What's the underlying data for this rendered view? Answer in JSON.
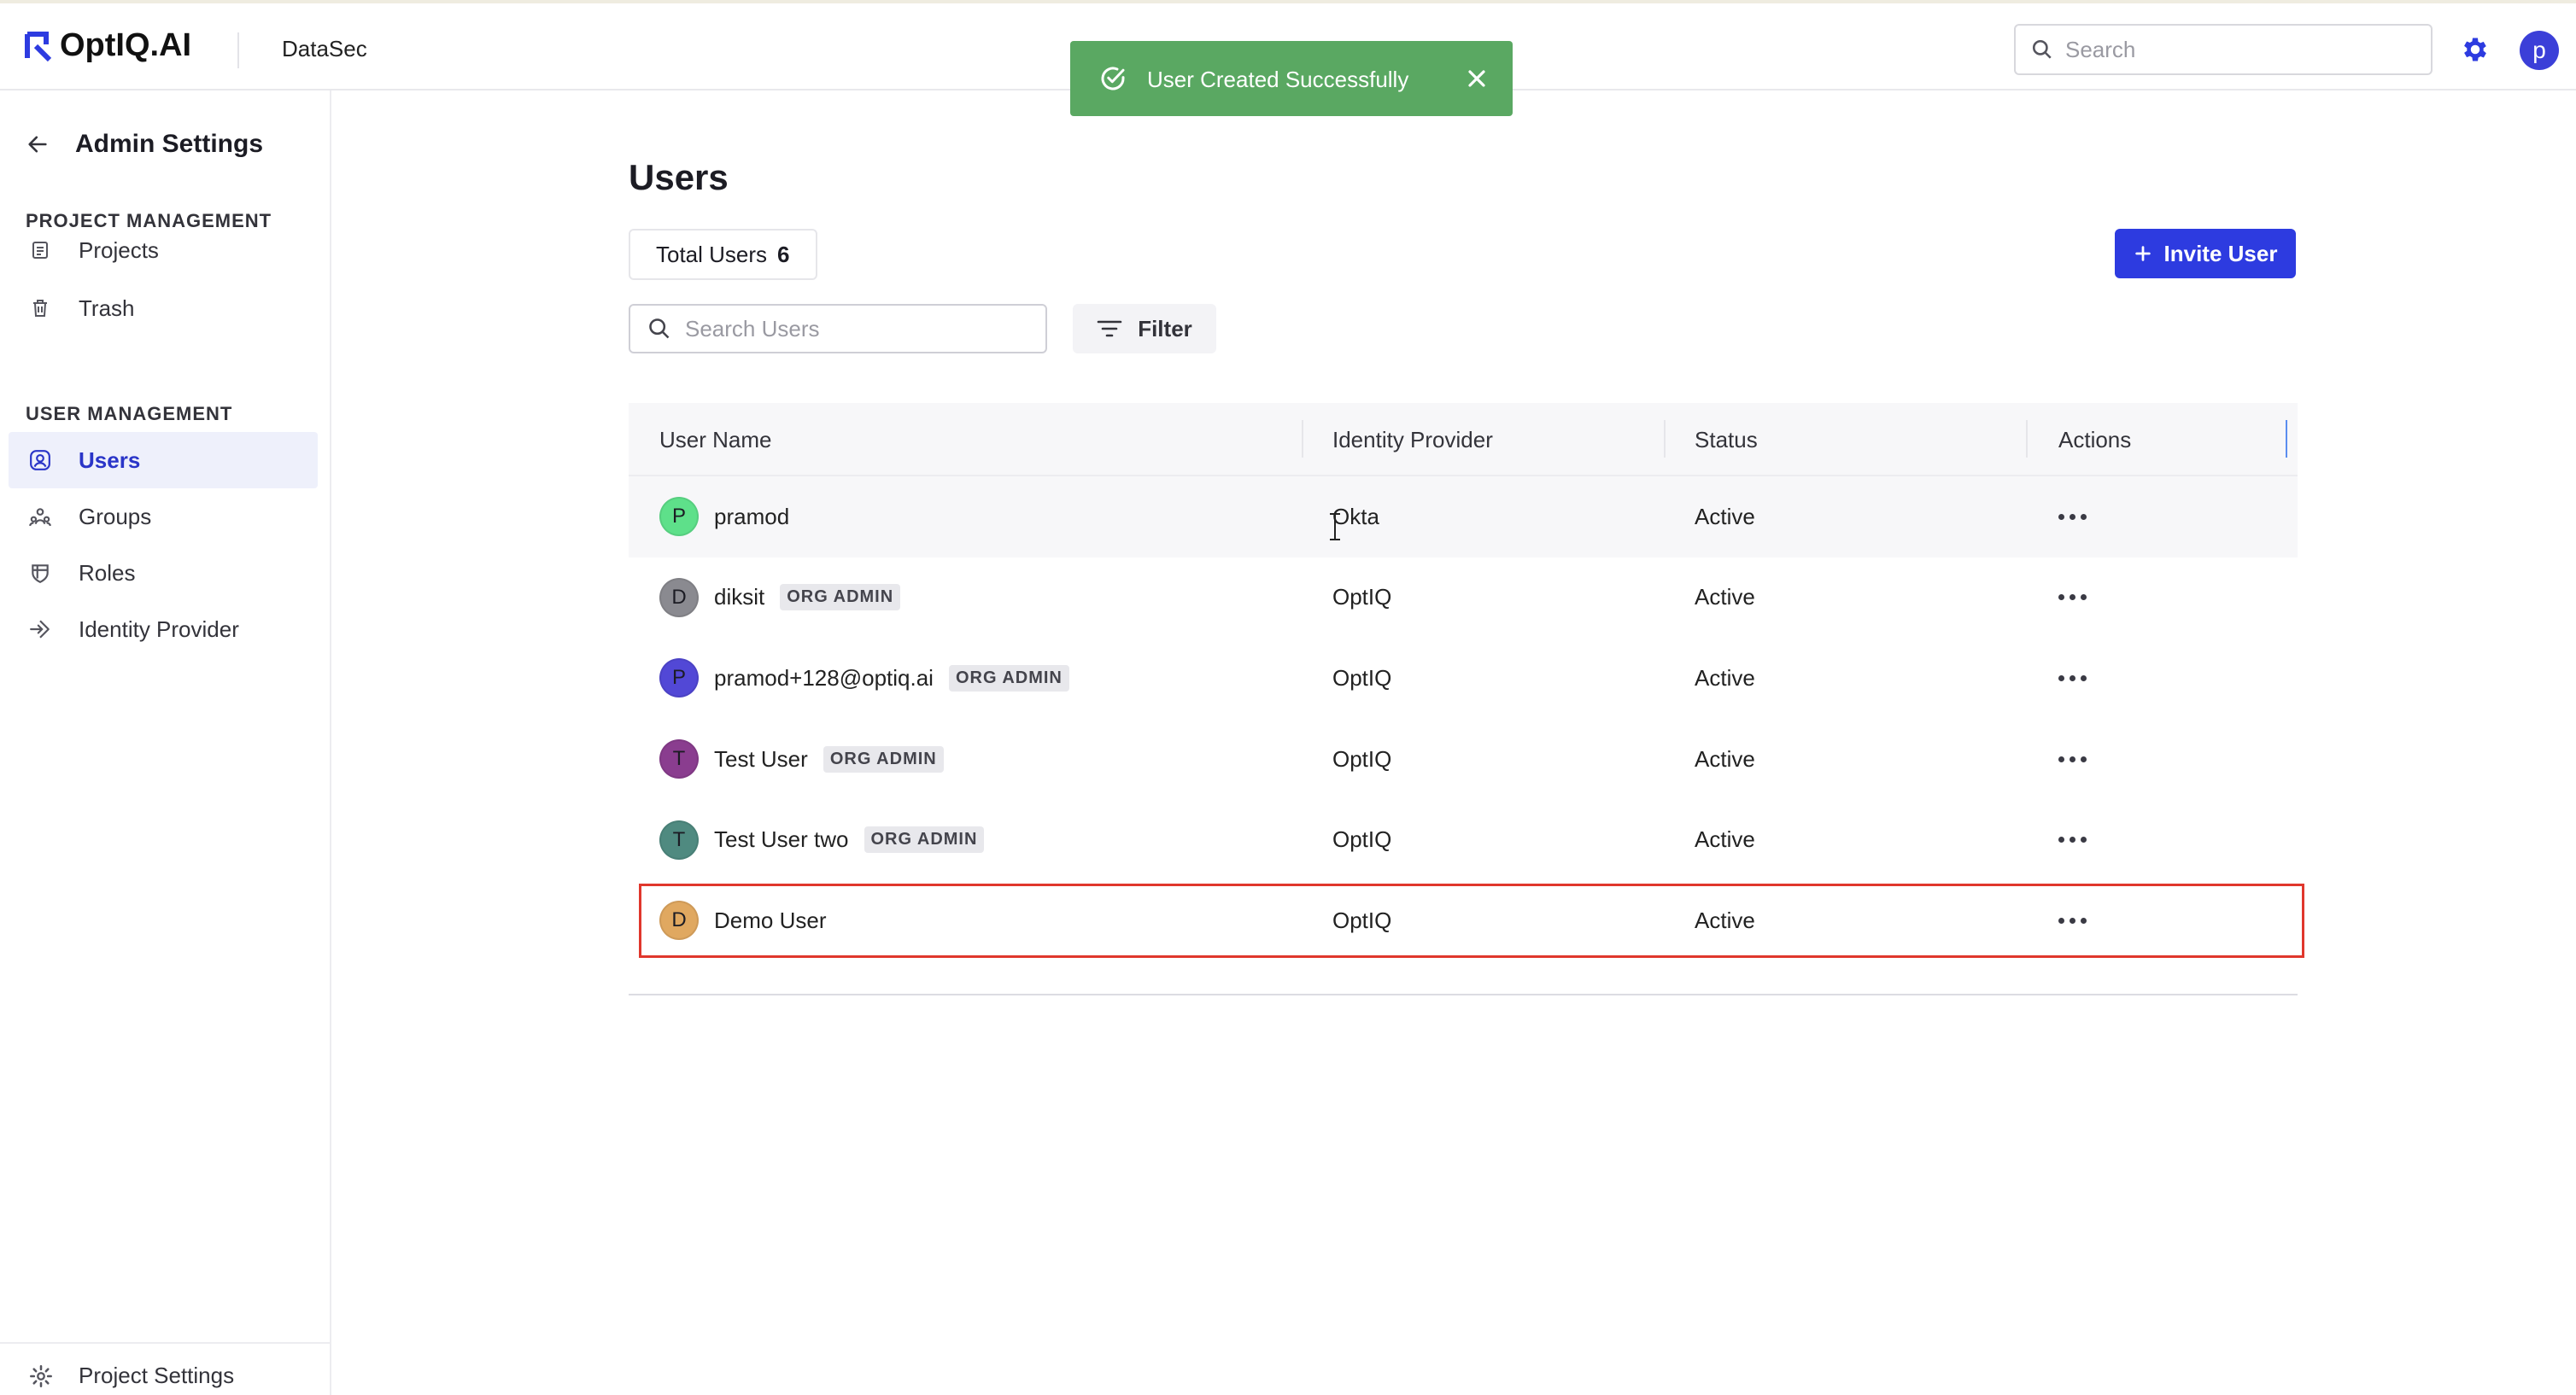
{
  "header": {
    "logo_text": "OptIQ.AI",
    "project_name": "DataSec",
    "search_placeholder": "Search",
    "avatar_initial": "p",
    "accent": "#2d3be0"
  },
  "toast": {
    "message": "User Created Successfully",
    "color": "#5aa862"
  },
  "sidebar": {
    "back_title": "Admin Settings",
    "sections": [
      {
        "title": "PROJECT MANAGEMENT",
        "items": [
          {
            "label": "Projects",
            "icon": "document-icon"
          },
          {
            "label": "Trash",
            "icon": "trash-icon"
          }
        ]
      },
      {
        "title": "USER MANAGEMENT",
        "items": [
          {
            "label": "Users",
            "icon": "user-circle-icon",
            "active": true
          },
          {
            "label": "Groups",
            "icon": "groups-icon"
          },
          {
            "label": "Roles",
            "icon": "shield-icon"
          },
          {
            "label": "Identity Provider",
            "icon": "login-icon"
          }
        ]
      }
    ],
    "footer_label": "Project Settings"
  },
  "main": {
    "title": "Users",
    "total_users_label": "Total Users",
    "total_users_count": "6",
    "invite_label": "Invite User",
    "search_placeholder": "Search Users",
    "filter_label": "Filter",
    "columns": [
      "User Name",
      "Identity Provider",
      "Status",
      "Actions"
    ],
    "rows": [
      {
        "initial": "P",
        "name": "pramod",
        "badge": "",
        "provider": "Okta",
        "status": "Active",
        "avatar_color": "#5ee08a"
      },
      {
        "initial": "D",
        "name": "diksit",
        "badge": "ORG ADMIN",
        "provider": "OptIQ",
        "status": "Active",
        "avatar_color": "#8a8a90"
      },
      {
        "initial": "P",
        "name": "pramod+128@optiq.ai",
        "badge": "ORG ADMIN",
        "provider": "OptIQ",
        "status": "Active",
        "avatar_color": "#5248d6"
      },
      {
        "initial": "T",
        "name": "Test User",
        "badge": "ORG ADMIN",
        "provider": "OptIQ",
        "status": "Active",
        "avatar_color": "#8a3d8f"
      },
      {
        "initial": "T",
        "name": "Test User two",
        "badge": "ORG ADMIN",
        "provider": "OptIQ",
        "status": "Active",
        "avatar_color": "#4f8a80"
      },
      {
        "initial": "D",
        "name": "Demo User",
        "badge": "",
        "provider": "OptIQ",
        "status": "Active",
        "avatar_color": "#e0a860",
        "highlighted": true
      }
    ]
  }
}
